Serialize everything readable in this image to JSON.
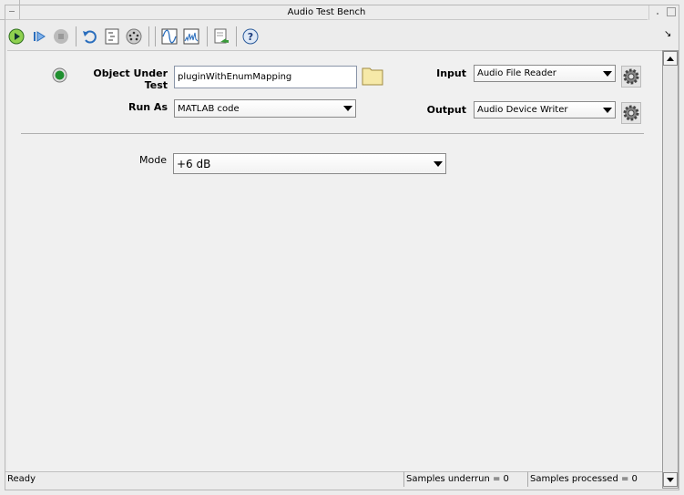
{
  "window": {
    "title": "Audio Test Bench"
  },
  "toolbar": {
    "buttons": [
      "run",
      "step",
      "stop",
      "reset",
      "generate-code",
      "midi",
      "time-scope",
      "spectrum-analyzer",
      "export",
      "help"
    ]
  },
  "form": {
    "object_under_test_label": "Object Under Test",
    "object_under_test_value": "pluginWithEnumMapping",
    "run_as_label": "Run As",
    "run_as_value": "MATLAB code",
    "input_label": "Input",
    "input_value": "Audio File Reader",
    "output_label": "Output",
    "output_value": "Audio Device Writer",
    "mode_label": "Mode",
    "mode_value": "+6 dB"
  },
  "status": {
    "ready": "Ready",
    "underrun": "Samples underrun = 0",
    "processed": "Samples processed = 0"
  },
  "colors": {
    "run_green": "#2e9a2e",
    "status_led": "#1f8f2f",
    "accent_blue": "#2a6ebd"
  }
}
